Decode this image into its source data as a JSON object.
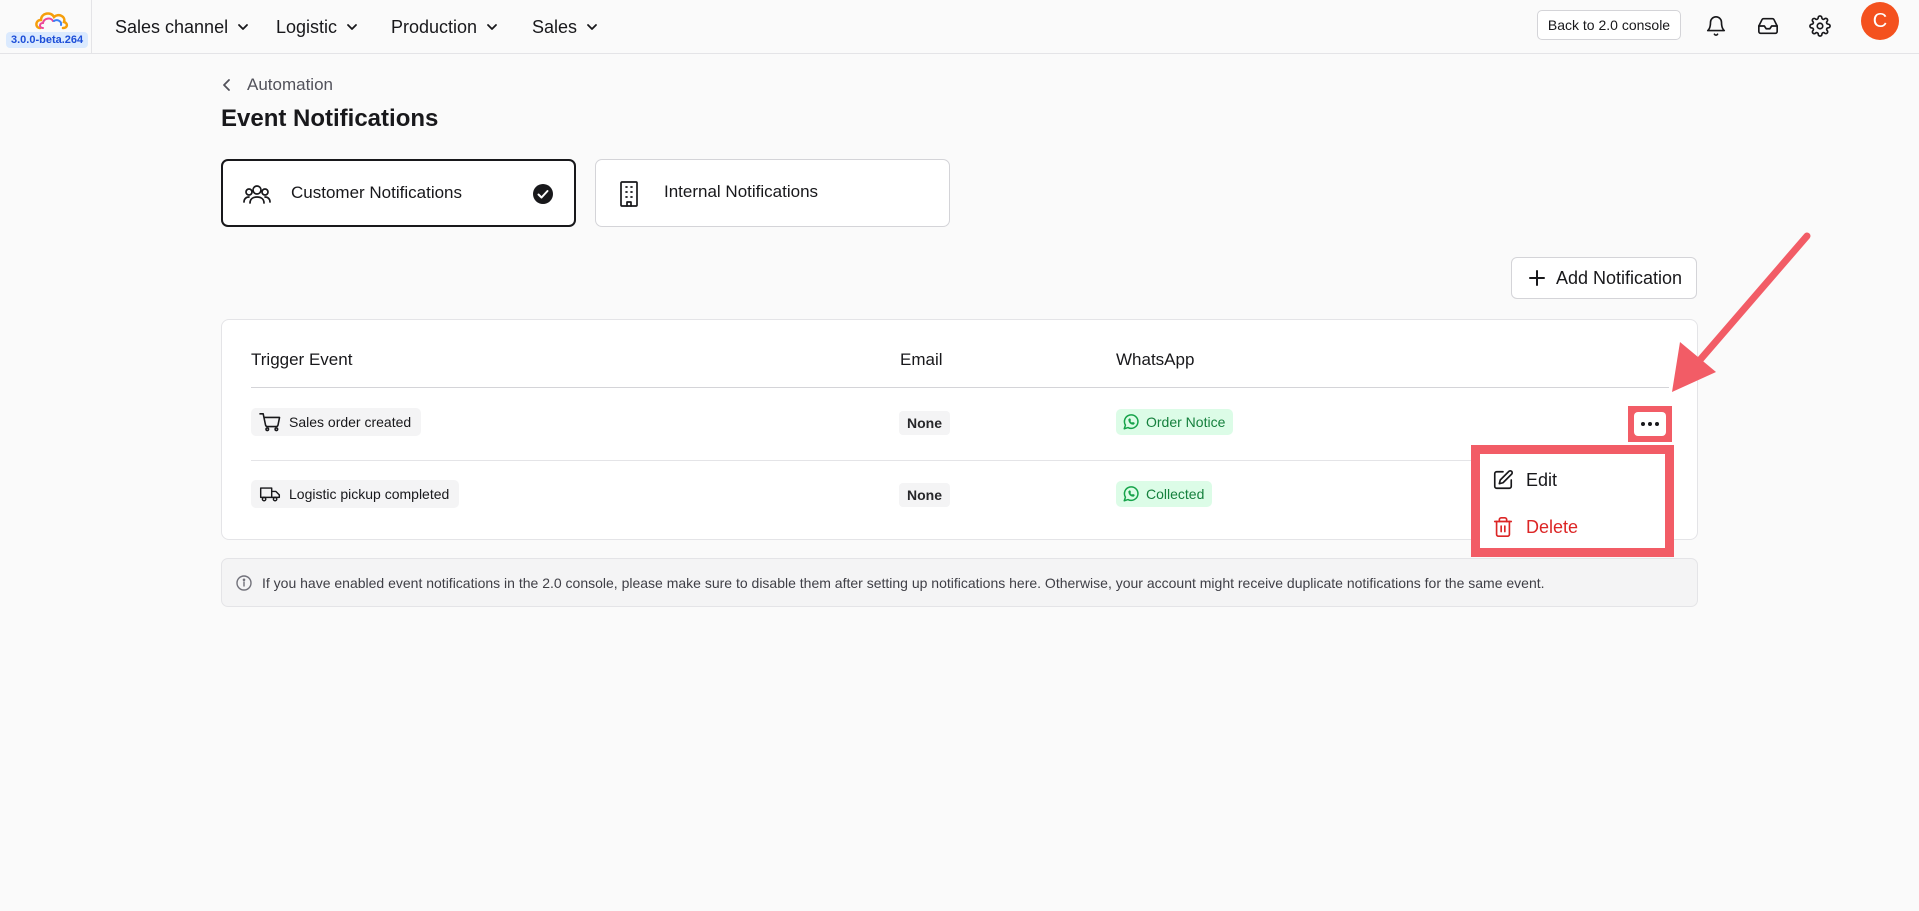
{
  "app": {
    "version": "3.0.0-beta.264",
    "accent_color": "#f4511e",
    "highlight_color": "#f25c66"
  },
  "nav": {
    "items": [
      {
        "label": "Sales channel"
      },
      {
        "label": "Logistic"
      },
      {
        "label": "Production"
      },
      {
        "label": "Sales"
      }
    ],
    "back_button": "Back to 2.0 console",
    "avatar_initial": "C",
    "icons": [
      "bell-icon",
      "inbox-icon",
      "gear-icon"
    ]
  },
  "page": {
    "breadcrumb": "Automation",
    "title": "Event Notifications"
  },
  "tabs": [
    {
      "label": "Customer Notifications",
      "icon": "users-icon",
      "active": true
    },
    {
      "label": "Internal Notifications",
      "icon": "building-icon",
      "active": false
    }
  ],
  "add_button": "Add Notification",
  "table": {
    "columns": [
      "Trigger Event",
      "Email",
      "WhatsApp"
    ],
    "rows": [
      {
        "trigger": "Sales order created",
        "trigger_icon": "cart-icon",
        "email": "None",
        "whatsapp": "Order Notice"
      },
      {
        "trigger": "Logistic pickup completed",
        "trigger_icon": "truck-icon",
        "email": "None",
        "whatsapp": "Collected"
      }
    ]
  },
  "row_menu": {
    "edit": "Edit",
    "delete": "Delete"
  },
  "info_banner": "If you have enabled event notifications in the 2.0 console, please make sure to disable them after setting up notifications here. Otherwise, your account might receive duplicate notifications for the same event."
}
